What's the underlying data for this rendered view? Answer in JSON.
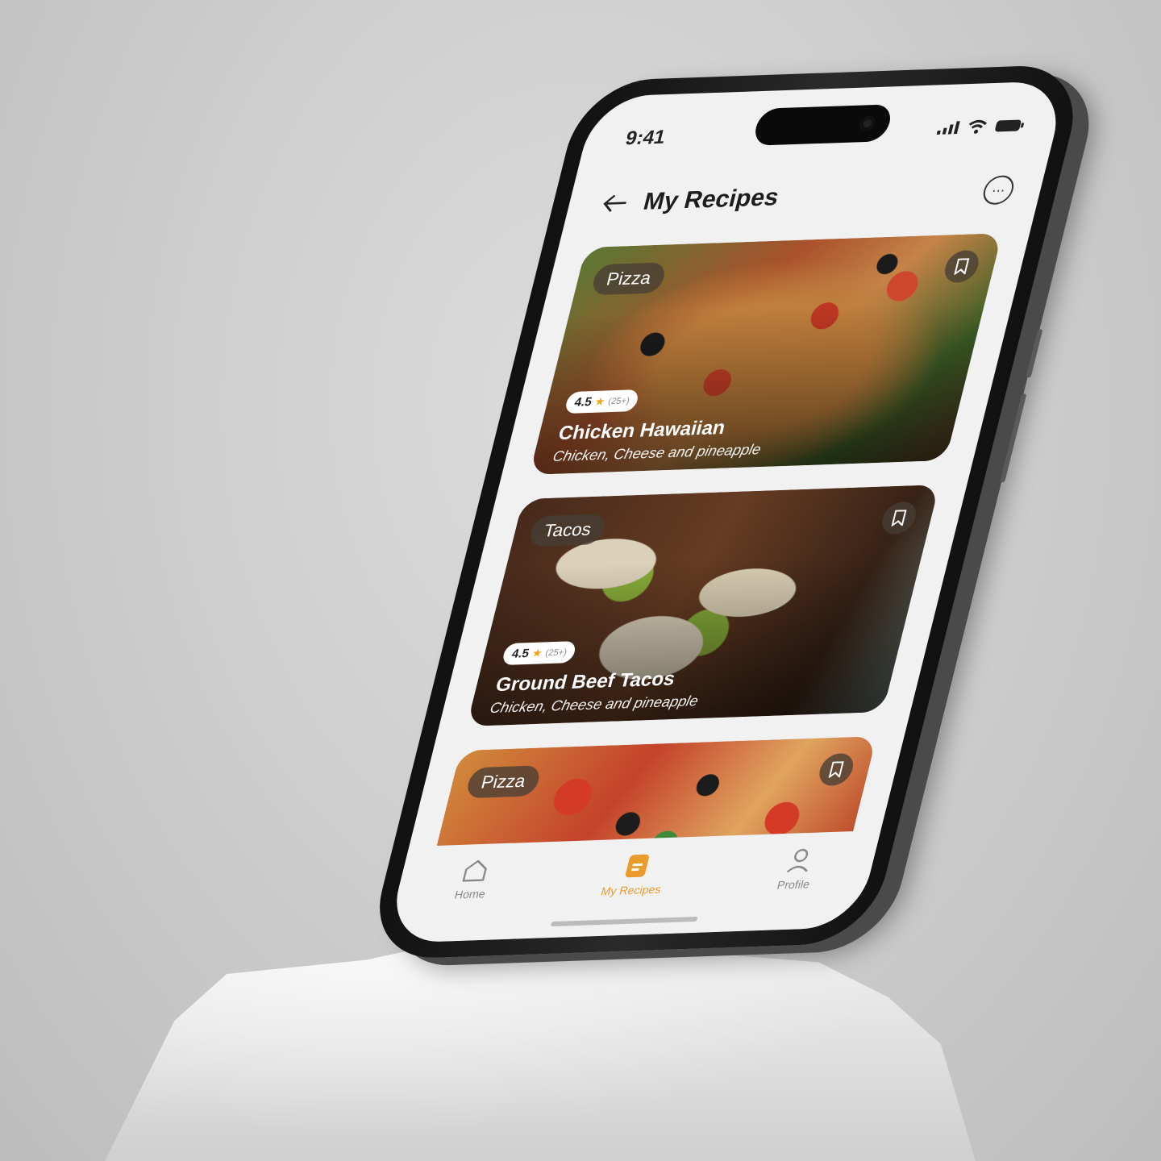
{
  "status_bar": {
    "time": "9:41"
  },
  "header": {
    "title": "My Recipes",
    "back_icon": "arrow-left-icon",
    "more_icon": "more-horizontal-icon"
  },
  "cards": [
    {
      "category": "Pizza",
      "rating": "4.5",
      "rating_count": "(25+)",
      "name": "Chicken Hawaiian",
      "description": "Chicken, Cheese and pineapple"
    },
    {
      "category": "Tacos",
      "rating": "4.5",
      "rating_count": "(25+)",
      "name": "Ground Beef Tacos",
      "description": "Chicken, Cheese and pineapple"
    },
    {
      "category": "Pizza"
    }
  ],
  "tabbar": {
    "items": [
      {
        "label": "Home",
        "icon": "home-icon"
      },
      {
        "label": "My Recipes",
        "icon": "recipe-book-icon",
        "active": true
      },
      {
        "label": "Profile",
        "icon": "user-icon"
      }
    ]
  },
  "colors": {
    "accent": "#e99b2c",
    "background": "#f1f1f1",
    "chip": "#463e34"
  }
}
